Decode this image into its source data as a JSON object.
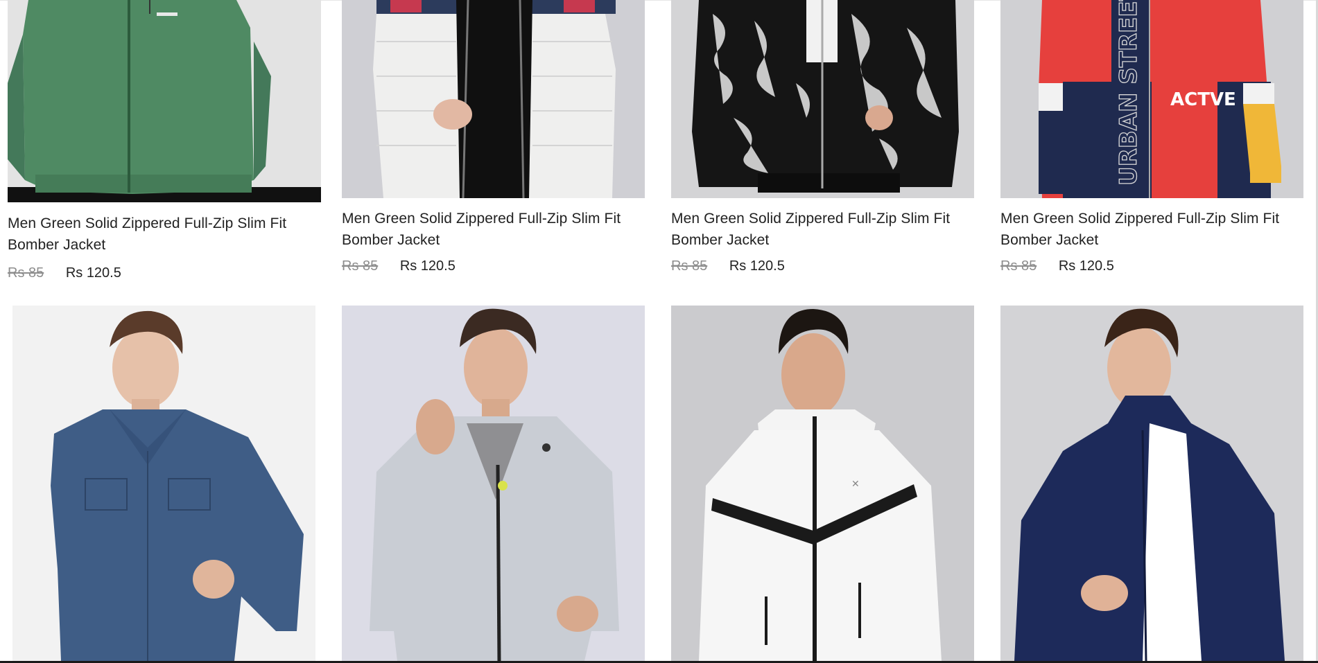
{
  "products": [
    {
      "title": "Men Green Solid Zippered Full-Zip Slim Fit Bomber Jacket",
      "old_price": "Rs 85",
      "new_price": "Rs 120.5",
      "image": "green-zip-jacket",
      "bg": "#e3e3e3",
      "color": "#4f8a63"
    },
    {
      "title": "Men Green Solid Zippered Full-Zip Slim Fit Bomber Jacket",
      "old_price": "Rs 85",
      "new_price": "Rs 120.5",
      "image": "white-puffer-jacket",
      "bg": "#cfcfd4",
      "color": "#f0f0ef"
    },
    {
      "title": "Men Green Solid Zippered Full-Zip Slim Fit Bomber Jacket",
      "old_price": "Rs 85",
      "new_price": "Rs 120.5",
      "image": "marble-print-bomber",
      "bg": "#d4d4d6",
      "color": "#151515"
    },
    {
      "title": "Men Green Solid Zippered Full-Zip Slim Fit Bomber Jacket",
      "old_price": "Rs 85",
      "new_price": "Rs 120.5",
      "image": "urban-street-colorblock-jacket",
      "bg": "#d0d0d3",
      "color": "#e6403d",
      "print_text_1": "URBAN STREET",
      "print_text_2": "ACTVE"
    },
    {
      "image": "denim-jacket",
      "bg": "#f2f2f2",
      "color": "#3f5d86"
    },
    {
      "image": "light-grey-track-jacket",
      "bg": "#dcdce6",
      "color": "#c9cdd4"
    },
    {
      "image": "white-hooded-windbreaker",
      "bg": "#cbcbce",
      "color": "#f6f6f6"
    },
    {
      "image": "navy-fleece-jacket",
      "bg": "#d3d3d6",
      "color": "#1d2a5a"
    }
  ]
}
